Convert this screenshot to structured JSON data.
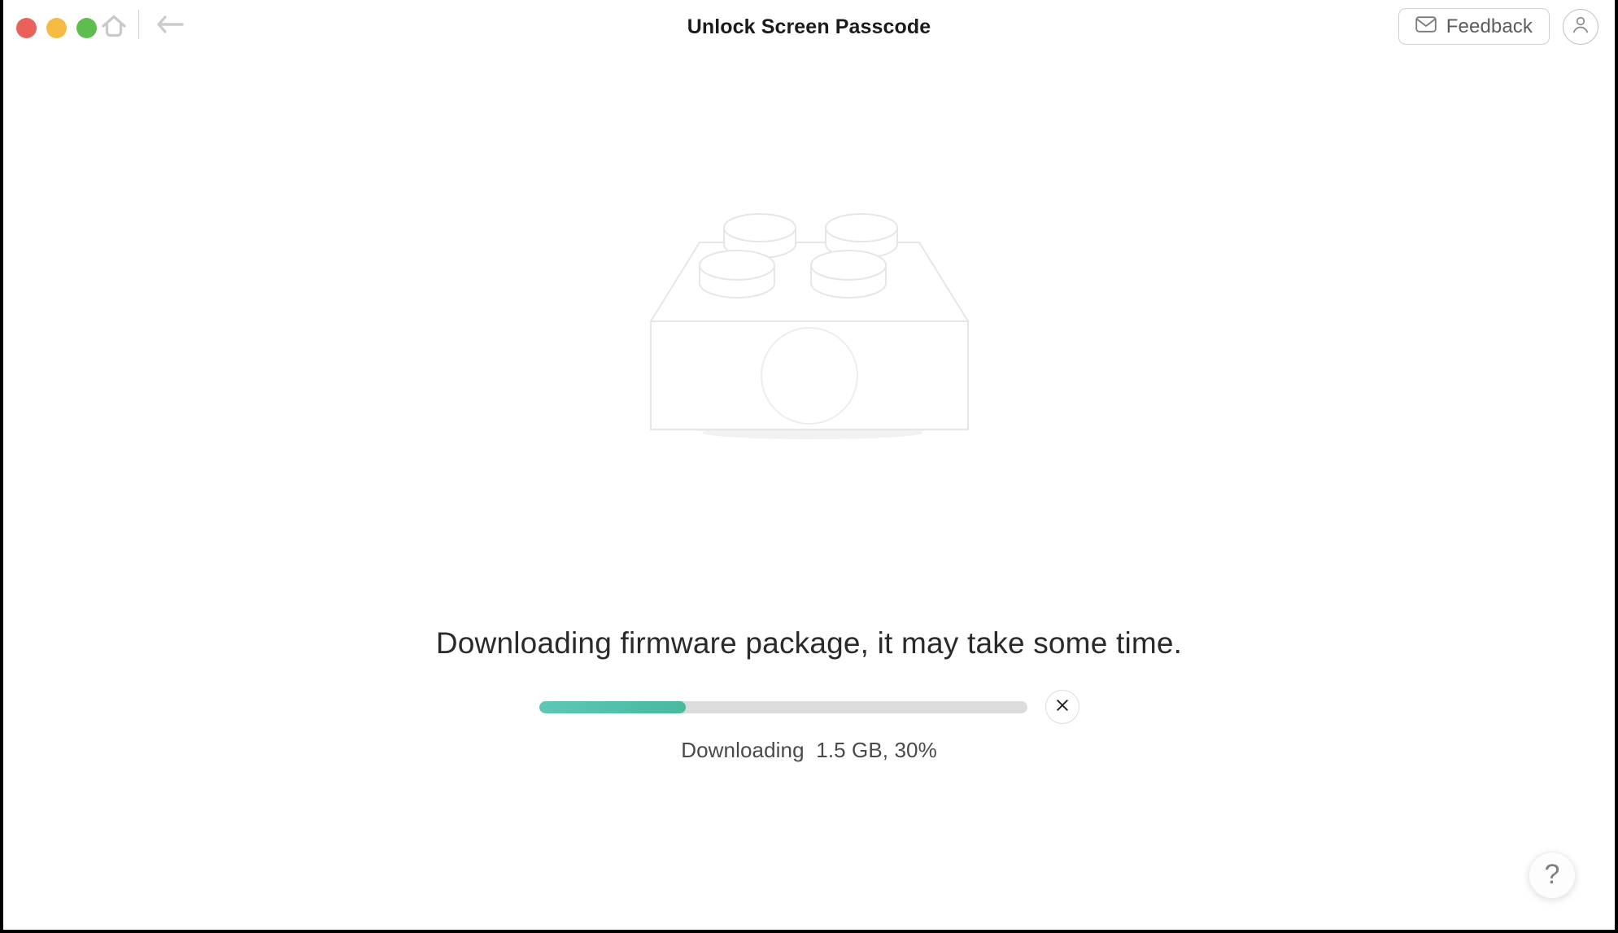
{
  "window": {
    "title": "Unlock Screen Passcode",
    "traffic_lights": [
      {
        "name": "close",
        "color": "#e8615a"
      },
      {
        "name": "minimize",
        "color": "#f5bb42"
      },
      {
        "name": "zoom",
        "color": "#5dbd4e"
      }
    ],
    "nav": {
      "home_icon": "home-icon",
      "back_icon": "back-arrow-icon"
    },
    "feedback": {
      "label": "Feedback",
      "icon": "envelope-icon"
    },
    "account": {
      "icon": "user-avatar-icon"
    }
  },
  "main": {
    "illustration": {
      "name": "firmware-package-brick-illustration",
      "stroke_color": "#e6e6e6"
    },
    "message": "Downloading firmware package, it may take some time.",
    "progress": {
      "percent": 30,
      "fill_color_start": "#5ec7b6",
      "fill_color_end": "#49b99f",
      "track_color": "#dcdcdc",
      "cancel_icon": "close-x-icon"
    },
    "status": "Downloading  1.5 GB, 30%",
    "downloaded_size": "1.5 GB",
    "help": {
      "glyph": "?",
      "icon": "question-mark-icon"
    }
  }
}
